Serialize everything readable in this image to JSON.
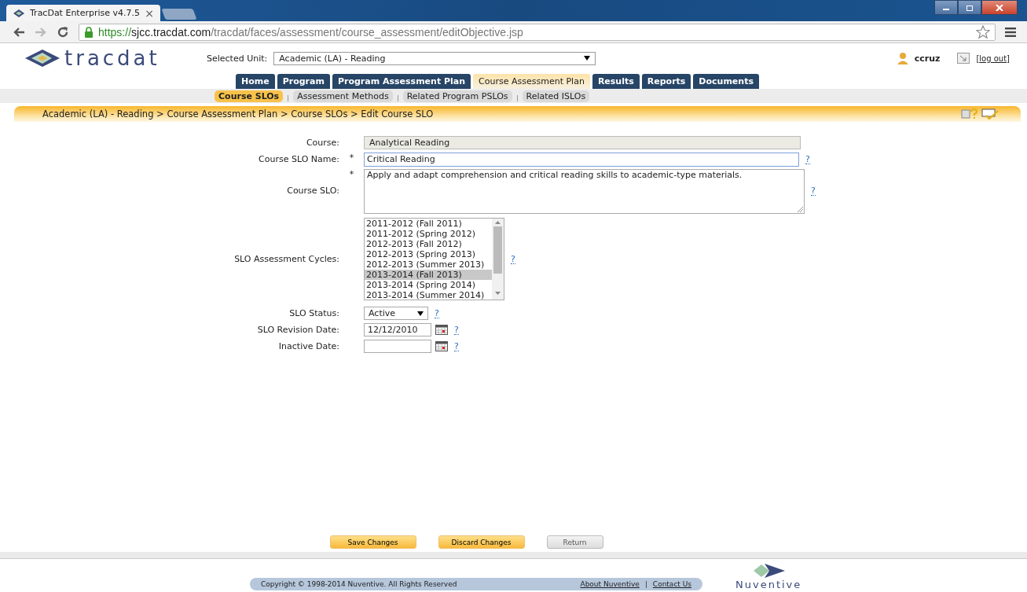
{
  "browser": {
    "tab_title": "TracDat Enterprise v4.7.5",
    "tab_close": "×",
    "url_scheme": "https://",
    "url_host": "sjcc.tracdat.com",
    "url_path": "/tracdat/faces/assessment/course_assessment/editObjective.jsp"
  },
  "header": {
    "logo_text": "tracdat",
    "unit_label": "Selected Unit:",
    "unit_value": "Academic (LA) - Reading",
    "user": "ccruz",
    "logout_open": "[",
    "logout": "log out",
    "logout_close": "]"
  },
  "tabs": [
    {
      "label": "Home",
      "selected": false
    },
    {
      "label": "Program",
      "selected": false
    },
    {
      "label": "Program Assessment Plan",
      "selected": false
    },
    {
      "label": "Course Assessment Plan",
      "selected": true
    },
    {
      "label": "Results",
      "selected": false
    },
    {
      "label": "Reports",
      "selected": false
    },
    {
      "label": "Documents",
      "selected": false
    }
  ],
  "subtabs": [
    {
      "label": "Course SLOs",
      "selected": true
    },
    {
      "label": "Assessment Methods",
      "selected": false
    },
    {
      "label": "Related Program PSLOs",
      "selected": false
    },
    {
      "label": "Related ISLOs",
      "selected": false
    }
  ],
  "breadcrumb": "Academic (LA) - Reading > Course Assessment Plan > Course SLOs > Edit Course SLO",
  "form": [
    {
      "kind": "readonly",
      "label": "Course:",
      "value": "Analytical Reading"
    },
    {
      "kind": "text",
      "label": "Course SLO Name:",
      "required_mark": "*",
      "value": "Critical Reading",
      "help": "?"
    },
    {
      "kind": "textarea",
      "label": "Course SLO:",
      "required_mark": "*",
      "value": "Apply and adapt comprehension and critical reading skills to academic-type materials.",
      "help": "?"
    },
    {
      "kind": "listbox",
      "label": "SLO Assessment Cycles:",
      "help": "?",
      "options": [
        {
          "label": "2011-2012 (Fall 2011)",
          "selected": false
        },
        {
          "label": "2011-2012 (Spring 2012)",
          "selected": false
        },
        {
          "label": "2012-2013 (Fall 2012)",
          "selected": false
        },
        {
          "label": "2012-2013 (Spring 2013)",
          "selected": false
        },
        {
          "label": "2012-2013 (Summer 2013)",
          "selected": false
        },
        {
          "label": "2013-2014 (Fall 2013)",
          "selected": true
        },
        {
          "label": "2013-2014 (Spring 2014)",
          "selected": false
        },
        {
          "label": "2013-2014 (Summer 2014)",
          "selected": false
        }
      ]
    },
    {
      "kind": "select",
      "label": "SLO Status:",
      "value": "Active",
      "help": "?"
    },
    {
      "kind": "date",
      "label": "SLO Revision Date:",
      "value": "12/12/2010",
      "help": "?"
    },
    {
      "kind": "date",
      "label": "Inactive Date:",
      "help": "?"
    }
  ],
  "buttons": [
    {
      "label": "Save Changes",
      "kind": "primary"
    },
    {
      "label": "Discard Changes",
      "kind": "primary"
    },
    {
      "label": "Return",
      "kind": "secondary"
    }
  ],
  "footer": {
    "copyright": "Copyright © 1998-2014 Nuventive. All Rights Reserved",
    "links": [
      "About Nuventive",
      "Contact Us"
    ],
    "logo_text": "Nuventive"
  }
}
